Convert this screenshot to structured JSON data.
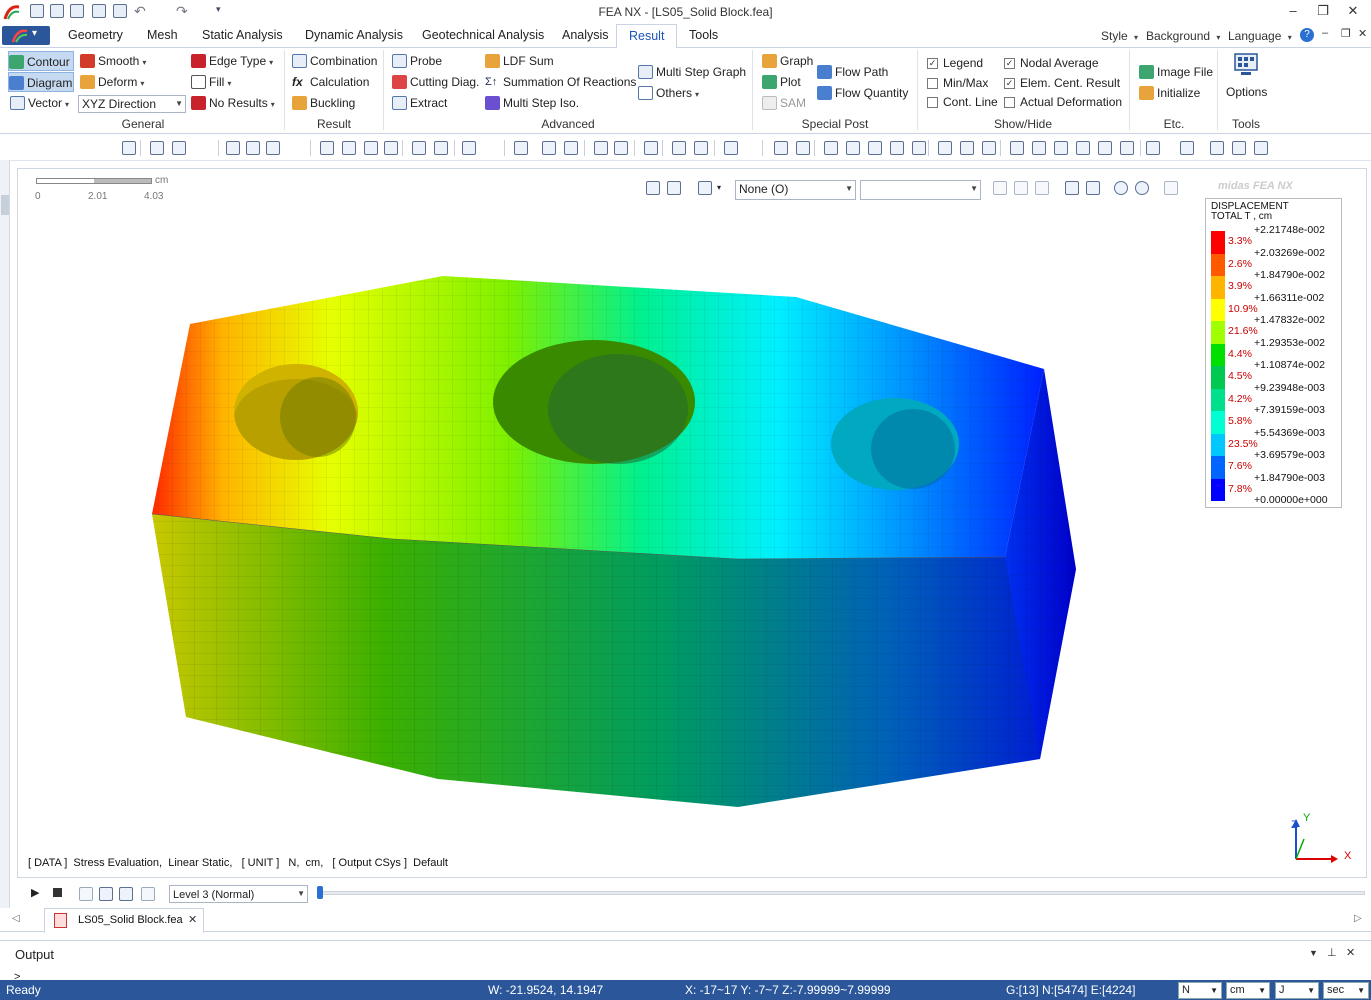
{
  "titlebar": {
    "title": "FEA NX - [LS05_Solid Block.fea]"
  },
  "menu": {
    "tabs": [
      "Geometry",
      "Mesh",
      "Static Analysis",
      "Dynamic Analysis",
      "Geotechnical Analysis",
      "Analysis",
      "Result",
      "Tools"
    ],
    "active": "Result",
    "right": {
      "style": "Style",
      "background": "Background",
      "language": "Language"
    }
  },
  "ribbon": {
    "general": {
      "label": "General",
      "contour": "Contour",
      "diagram": "Diagram",
      "vector": "Vector",
      "smooth": "Smooth",
      "deform": "Deform",
      "direction": "XYZ Direction",
      "edge_type": "Edge Type",
      "fill": "Fill",
      "no_results": "No Results"
    },
    "result": {
      "label": "Result",
      "combination": "Combination",
      "calculation": "Calculation",
      "buckling": "Buckling"
    },
    "advanced": {
      "label": "Advanced",
      "probe": "Probe",
      "cutting_diag": "Cutting Diag.",
      "extract": "Extract",
      "ldf_sum": "LDF Sum",
      "summation": "Summation Of Reactions",
      "multi_step_iso": "Multi Step Iso.",
      "multi_step_graph": "Multi Step Graph",
      "others": "Others"
    },
    "special_post": {
      "label": "Special Post",
      "graph": "Graph",
      "plot": "Plot",
      "sam": "SAM",
      "flow_path": "Flow Path",
      "flow_quantity": "Flow Quantity"
    },
    "show_hide": {
      "label": "Show/Hide",
      "legend": "Legend",
      "min_max": "Min/Max",
      "cont_line": "Cont. Line",
      "nodal_average": "Nodal Average",
      "elem_cent": "Elem. Cent. Result",
      "actual_deformation": "Actual Deformation"
    },
    "etc": {
      "label": "Etc.",
      "image_file": "Image File",
      "initialize": "Initialize"
    },
    "tools": {
      "label": "Tools",
      "options": "Options"
    }
  },
  "viewport": {
    "scale": {
      "unit": "cm",
      "ticks": [
        "0",
        "2.01",
        "4.03"
      ]
    },
    "view_select": "None (O)",
    "watermark": "midas FEA NX",
    "info": "[ DATA ]  Stress Evaluation,  Linear Static,   [ UNIT ]   N,  cm,   [ Output CSys ]  Default",
    "triad": {
      "x": "X",
      "y": "Y",
      "z": "Z"
    }
  },
  "legend": {
    "title1": "DISPLACEMENT",
    "title2": "TOTAL T , cm",
    "values": [
      "+2.21748e-002",
      "+2.03269e-002",
      "+1.84790e-002",
      "+1.66311e-002",
      "+1.47832e-002",
      "+1.29353e-002",
      "+1.10874e-002",
      "+9.23948e-003",
      "+7.39159e-003",
      "+5.54369e-003",
      "+3.69579e-003",
      "+1.84790e-003",
      "+0.00000e+000"
    ],
    "percents": [
      "3.3%",
      "2.6%",
      "3.9%",
      "10.9%",
      "21.6%",
      "4.4%",
      "4.5%",
      "4.2%",
      "5.8%",
      "23.5%",
      "7.6%",
      "7.8%"
    ],
    "colors": [
      "#ff0000",
      "#ff5a00",
      "#ffb400",
      "#ffff00",
      "#a0ff00",
      "#00e000",
      "#00c850",
      "#00e08c",
      "#00ffd2",
      "#00c8ff",
      "#0064ff",
      "#0000ff"
    ]
  },
  "animation": {
    "level": "Level 3 (Normal)"
  },
  "doc_tab": {
    "name": "LS05_Solid Block.fea"
  },
  "output": {
    "title": "Output",
    "prompt": ">"
  },
  "status": {
    "ready": "Ready",
    "w": "W: -21.9524, 14.1947",
    "xyz": "X: -17~17 Y: -7~7 Z:-7.99999~7.99999",
    "counts": "G:[13] N:[5474] E:[4224]",
    "force": "N",
    "length": "cm",
    "energy": "J",
    "time": "sec"
  }
}
